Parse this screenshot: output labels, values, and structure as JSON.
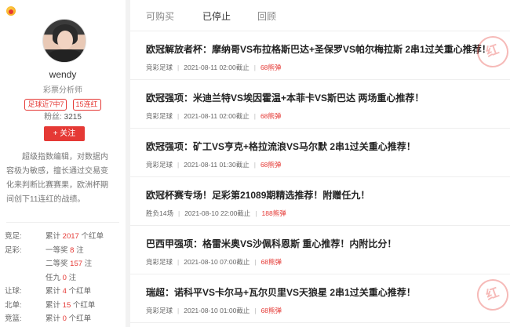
{
  "profile": {
    "name": "wendy",
    "role": "彩票分析师",
    "badges": [
      "足球近7中7",
      "15连红"
    ],
    "fans_label": "粉丝:",
    "fans_count": "3215",
    "follow_label": "+ 关注",
    "bio": "超级指数编辑，对数据内容极为敏感，擅长通过交易变化来判断比赛赛果，欧洲杯期间创下11连红的战绩。",
    "stats": [
      {
        "label": "竞足:",
        "pre": "累计",
        "num": "2017",
        "post": "个红单"
      },
      {
        "label": "足彩:",
        "pre": "一等奖",
        "num": "8",
        "post": "注"
      },
      {
        "label": "",
        "pre": "二等奖",
        "num": "157",
        "post": "注"
      },
      {
        "label": "",
        "pre": "任九",
        "num": "0",
        "post": "注"
      },
      {
        "label": "让球:",
        "pre": "累计",
        "num": "4",
        "post": "个红单"
      },
      {
        "label": "北单:",
        "pre": "累计",
        "num": "15",
        "post": "个红单"
      },
      {
        "label": "竞篮:",
        "pre": "累计",
        "num": "0",
        "post": "个红单"
      }
    ]
  },
  "tabs": [
    {
      "label": "可购买",
      "active": false
    },
    {
      "label": "已停止",
      "active": true
    },
    {
      "label": "回顾",
      "active": false
    }
  ],
  "articles": [
    {
      "title": "欧冠解放者杯：摩纳哥VS布拉格斯巴达+圣保罗VS帕尔梅拉斯 2串1过关重心推荐！",
      "category": "竞彩足球",
      "time": "2021-08-11 02:00截止",
      "price": "68熊弹",
      "stamp": "红"
    },
    {
      "title": "欧冠强项：米迪兰特VS埃因霍温+本菲卡VS斯巴达 两场重心推荐！",
      "category": "竞彩足球",
      "time": "2021-08-11 02:00截止",
      "price": "68熊弹",
      "stamp": ""
    },
    {
      "title": "欧冠强项：矿工VS亨克+格拉流浪VS马尔默 2串1过关重心推荐！",
      "category": "竞彩足球",
      "time": "2021-08-11 01:30截止",
      "price": "68熊弹",
      "stamp": ""
    },
    {
      "title": "欧冠杯赛专场！足彩第21089期精选推荐！附赠任九！",
      "category": "胜负14场",
      "time": "2021-08-10 22:00截止",
      "price": "188熊弹",
      "stamp": ""
    },
    {
      "title": "巴西甲强项：格雷米奥VS沙佩科恩斯 重心推荐！内附比分！",
      "category": "竞彩足球",
      "time": "2021-08-10 07:00截止",
      "price": "68熊弹",
      "stamp": ""
    },
    {
      "title": "瑞超：诺科平VS卡尔马+瓦尔贝里VS天狼星 2串1过关重心推荐！",
      "category": "竞彩足球",
      "time": "2021-08-10 01:00截止",
      "price": "68熊弹",
      "stamp": "红"
    }
  ]
}
